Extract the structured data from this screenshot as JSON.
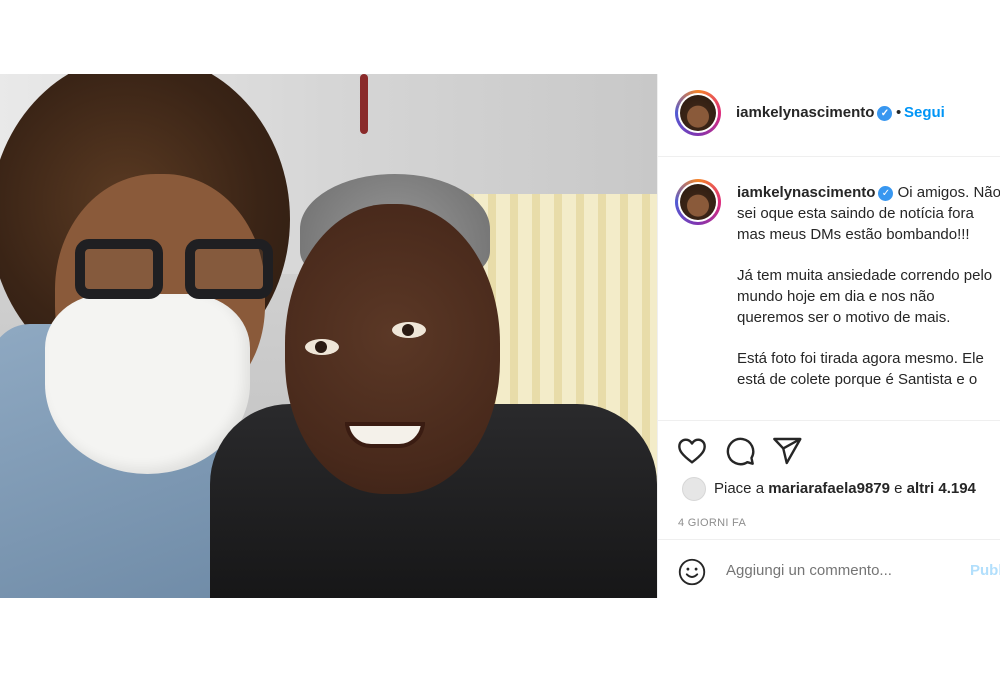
{
  "post": {
    "author": {
      "username": "iamkelynascimento",
      "verified": true,
      "follow_label": "Segui",
      "separator": "•"
    },
    "caption": {
      "username": "iamkelynascimento",
      "line1": "Oi amigos.",
      "paragraph1": "Não sei oque esta saindo de notícia fora mas meus DMs estão bombando!!!",
      "paragraph2": "Já tem muita ansiedade correndo pelo mundo hoje em dia e nos não queremos ser o motivo de mais.",
      "paragraph3": "Está foto foi tirada agora mesmo. Ele está de colete porque é Santista e o"
    },
    "actions": {
      "like_icon": "heart-icon",
      "comment_icon": "comment-icon",
      "share_icon": "paper-plane-icon"
    },
    "likes": {
      "prefix": "Piace a",
      "user": "mariarafaela9879",
      "connector": "e",
      "others": "altri 4.194"
    },
    "timestamp": "4 GIORNI FA",
    "comment": {
      "emoji_icon": "smiley-icon",
      "placeholder": "Aggiungi un commento...",
      "publish_label": "Publ"
    }
  },
  "colors": {
    "accent": "#0095f6",
    "verified": "#3897f0",
    "text": "#262626",
    "muted": "#8e8e8e",
    "border": "#efefef"
  }
}
